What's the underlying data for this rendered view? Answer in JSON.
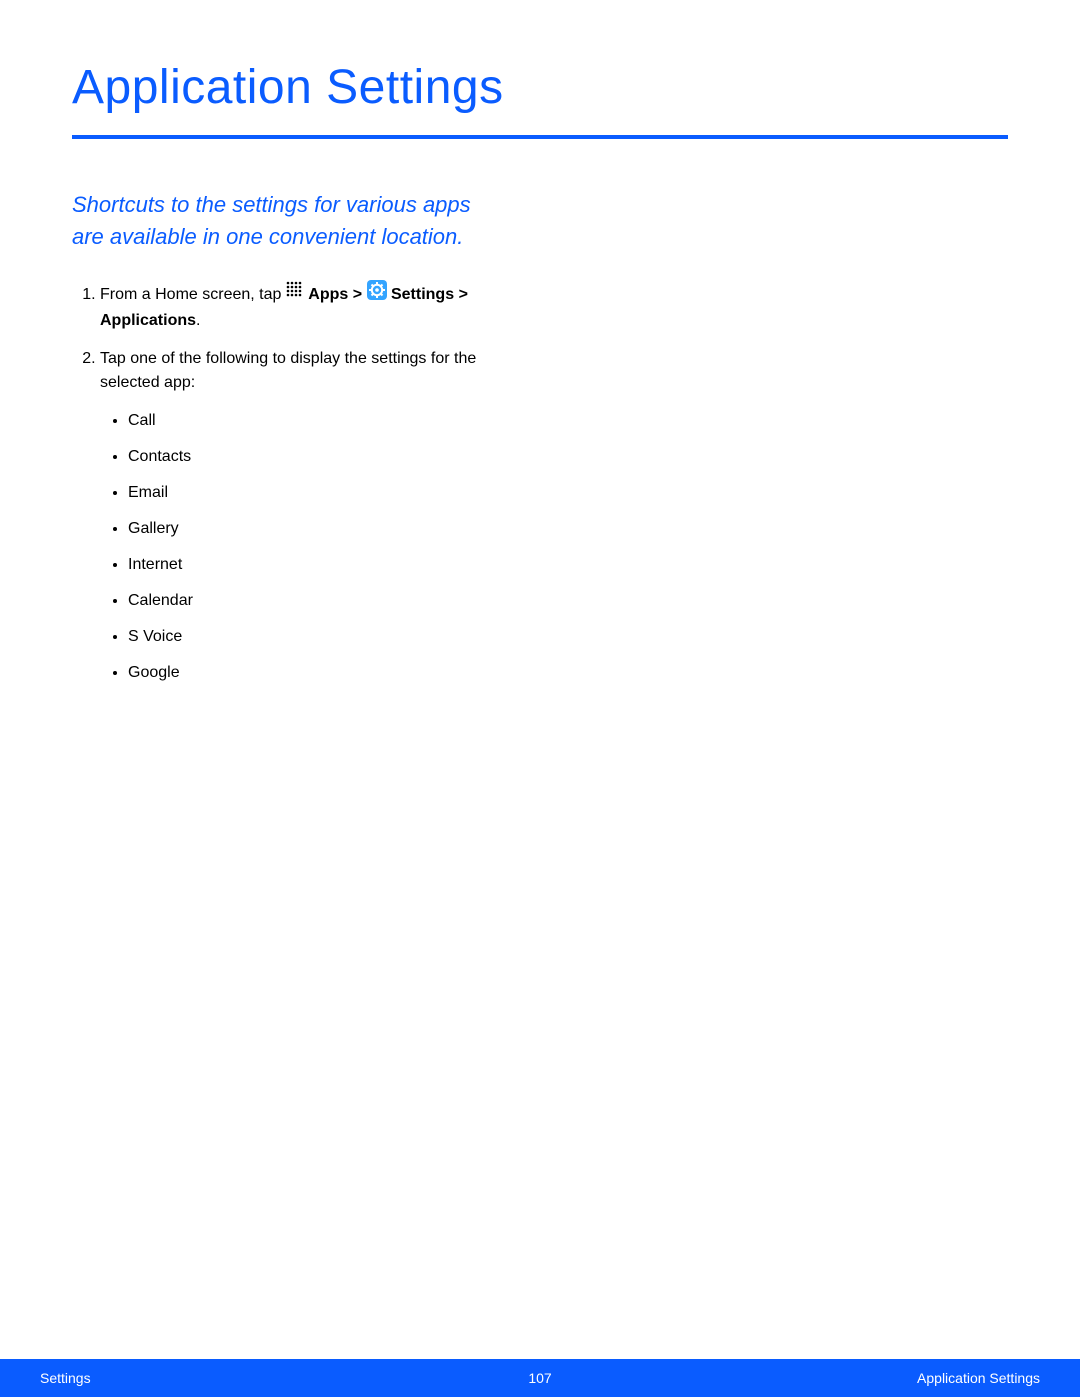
{
  "title": "Application Settings",
  "intro": "Shortcuts to the settings for various apps are available in one convenient location.",
  "steps": {
    "s1": {
      "prefix": "From a Home screen, tap ",
      "apps_label": "Apps",
      "sep1": " > ",
      "settings_label": "Settings",
      "sep2": " > ",
      "applications_label": "Applications",
      "period": "."
    },
    "s2": {
      "text": "Tap one of the following to display the settings for the selected app:",
      "bullets": [
        "Call",
        "Contacts",
        "Email",
        "Gallery",
        "Internet",
        "Calendar",
        "S Voice",
        "Google"
      ]
    }
  },
  "footer": {
    "left": "Settings",
    "center": "107",
    "right": "Application Settings"
  }
}
